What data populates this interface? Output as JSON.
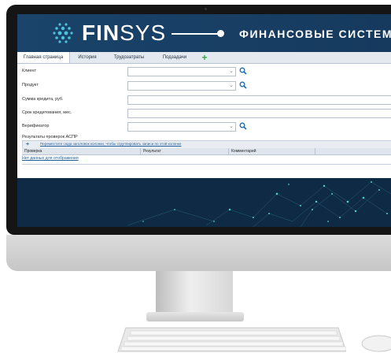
{
  "brand": {
    "name_bold": "FIN",
    "name_thin": "SYS",
    "subtitle": "ФИНАНСОВЫЕ СИСТЕМЫ"
  },
  "tabs": [
    {
      "label": "Главная страница",
      "active": true
    },
    {
      "label": "История",
      "active": false
    },
    {
      "label": "Трудозатраты",
      "active": false
    },
    {
      "label": "Подзадачи",
      "active": false
    }
  ],
  "tab_add_label": "+",
  "form": {
    "client_label": "Клиент",
    "product_label": "Продукт",
    "amount_label": "Сумма кредита, руб.",
    "term_label": "Срок кредитования, мес.",
    "verifier_label": "Верификатор"
  },
  "grid": {
    "caption": "Результаты проверок АСПР",
    "group_hint": "Переместите сюда заголовок колонки, чтобы сгруппировать записи по этой колонке",
    "columns": [
      "Проверка",
      "Результат",
      "Комментарий"
    ],
    "empty_text": "Нет данных для отображения"
  },
  "colors": {
    "header_bg": "#1a446b",
    "accent_blue": "#1f6fb4",
    "add_green": "#3aa84a",
    "screen_bg": "#0f2a45"
  },
  "icons": [
    "logo-mark-icon",
    "chevron-down-icon",
    "search-icon",
    "add-icon"
  ]
}
